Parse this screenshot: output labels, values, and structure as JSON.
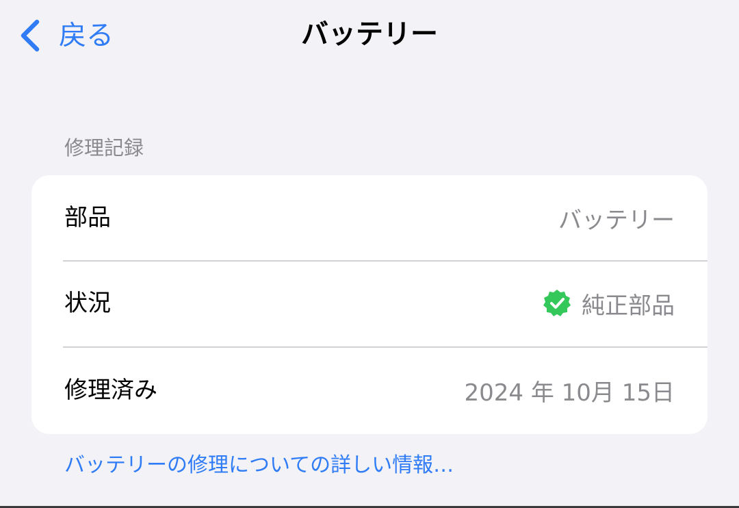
{
  "nav": {
    "back_label": "戻る",
    "title": "バッテリー",
    "back_icon": "chevron-left-icon"
  },
  "section": {
    "header": "修理記録",
    "rows": [
      {
        "label": "部品",
        "value": "バッテリー"
      },
      {
        "label": "状況",
        "value": "純正部品",
        "icon": "check-badge-icon"
      },
      {
        "label": "修理済み",
        "value": "2024 年 10月 15日"
      }
    ]
  },
  "footer_link": "バッテリーの修理についての詳しい情報…",
  "colors": {
    "accent": "#2f7cf6",
    "background": "#f2f2f7",
    "secondary_text": "#8a8a8e",
    "badge_green": "#34c759"
  }
}
